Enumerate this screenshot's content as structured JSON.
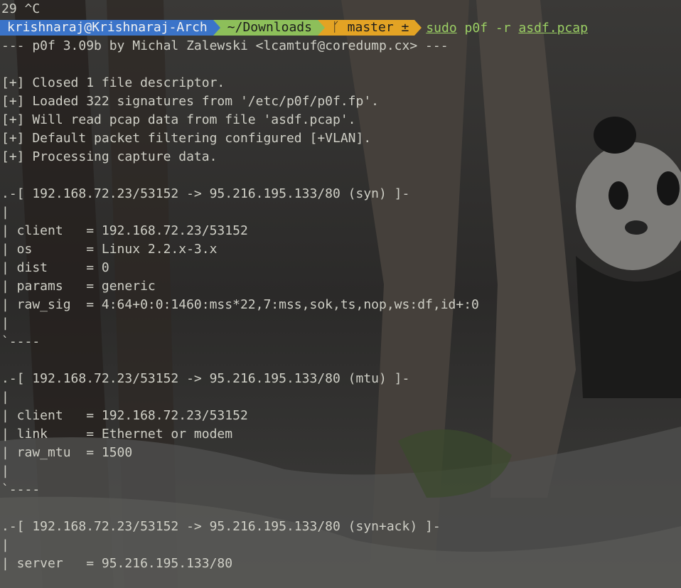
{
  "terminal": {
    "pre_line": "29 ^C",
    "prompt": {
      "user_host": "krishnaraj@Krishnaraj-Arch",
      "cwd": "~/Downloads",
      "git_icon": "branch-icon",
      "git_branch": "master ±",
      "cmd_sudo": "sudo",
      "cmd_prog": " p0f -r ",
      "cmd_file": "asdf.pcap"
    },
    "output": [
      "--- p0f 3.09b by Michal Zalewski <lcamtuf@coredump.cx> ---",
      "",
      "[+] Closed 1 file descriptor.",
      "[+] Loaded 322 signatures from '/etc/p0f/p0f.fp'.",
      "[+] Will read pcap data from file 'asdf.pcap'.",
      "[+] Default packet filtering configured [+VLAN].",
      "[+] Processing capture data.",
      "",
      ".-[ 192.168.72.23/53152 -> 95.216.195.133/80 (syn) ]-",
      "|",
      "| client   = 192.168.72.23/53152",
      "| os       = Linux 2.2.x-3.x",
      "| dist     = 0",
      "| params   = generic",
      "| raw_sig  = 4:64+0:0:1460:mss*22,7:mss,sok,ts,nop,ws:df,id+:0",
      "|",
      "`----",
      "",
      ".-[ 192.168.72.23/53152 -> 95.216.195.133/80 (mtu) ]-",
      "|",
      "| client   = 192.168.72.23/53152",
      "| link     = Ethernet or modem",
      "| raw_mtu  = 1500",
      "|",
      "`----",
      "",
      ".-[ 192.168.72.23/53152 -> 95.216.195.133/80 (syn+ack) ]-",
      "|",
      "| server   = 95.216.195.133/80"
    ]
  },
  "colors": {
    "user_segment": "#3b74c9",
    "dir_segment": "#8dbf5a",
    "git_segment": "#e3a324",
    "command": "#9bcf64",
    "text": "#cfcfc6"
  }
}
